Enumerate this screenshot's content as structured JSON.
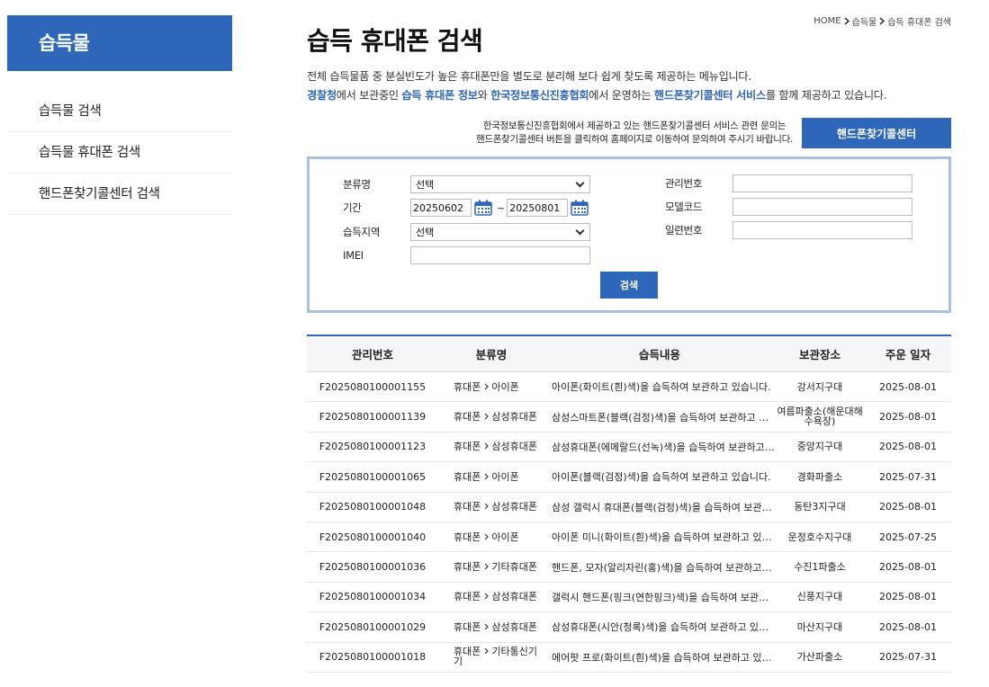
{
  "sidebar": {
    "title": "습득물",
    "items": [
      {
        "label": "습득물 검색"
      },
      {
        "label": "습득물 휴대폰 검색"
      },
      {
        "label": "핸드폰찾기콜센터 검색"
      }
    ]
  },
  "breadcrumb": [
    "HOME",
    "습득물",
    "습득 휴대폰 검색"
  ],
  "page": {
    "title": "습득 휴대폰 검색",
    "desc_line1": "전체 습득물품 중 분실빈도가 높은 휴대폰만을 별도로 분리해 보다 쉽게 찾도록 제공하는 메뉴입니다.",
    "desc_line2_parts": {
      "p1": "경찰청",
      "p2": "에서 보관중인 ",
      "p3": "습득 휴대폰 정보",
      "p4": "와 ",
      "p5": "한국정보통신진흥협회",
      "p6": "에서 운영하는 ",
      "p7": "핸드폰찾기콜센터 서비스",
      "p8": "를 함께 제공하고 있습니다."
    }
  },
  "callcenter": {
    "text_line1": "한국정보통신진흥협회에서 제공하고 있는 핸드폰찾기콜센터 서비스 관련 문의는",
    "text_line2": "핸드폰찾기콜센터 버튼을 클릭하여 홈페이지로 이동하여 문의하여 주시기 바랍니다.",
    "button_label": "핸드폰찾기콜센터"
  },
  "search_form": {
    "category_label": "분류명",
    "category_value": "선택",
    "period_label": "기간",
    "date_from": "20250602",
    "date_to": "20250801",
    "tilde": "~",
    "region_label": "습득지역",
    "region_value": "선택",
    "imei_label": "IMEI",
    "imei_value": "",
    "mgmt_no_label": "관리번호",
    "model_code_label": "모델코드",
    "serial_no_label": "일련번호",
    "search_button": "검색"
  },
  "table": {
    "headers": [
      "관리번호",
      "분류명",
      "습득내용",
      "보관장소",
      "주운 일자"
    ],
    "rows": [
      {
        "id": "F2025080100001155",
        "cat1": "휴대폰",
        "cat2": "아이폰",
        "content": "아이폰(화이트(흰)색)을 습득하여 보관하고 있습니다.",
        "place": "강서지구대",
        "date": "2025-08-01"
      },
      {
        "id": "F2025080100001139",
        "cat1": "휴대폰",
        "cat2": "삼성휴대폰",
        "content": "삼성스마트폰(블랙(검정)색)을 습득하여 보관하고 있습니다.",
        "place": "여름파출소(해운대해수욕장)",
        "date": "2025-08-01"
      },
      {
        "id": "F2025080100001123",
        "cat1": "휴대폰",
        "cat2": "삼성휴대폰",
        "content": "삼성휴대폰(에메랄드(선녹)색)을 습득하여 보관하고 있습니다.",
        "place": "중앙지구대",
        "date": "2025-08-01"
      },
      {
        "id": "F2025080100001065",
        "cat1": "휴대폰",
        "cat2": "아이폰",
        "content": "아이폰(블랙(검정)색)을 습득하여 보관하고 있습니다.",
        "place": "경화파출소",
        "date": "2025-07-31"
      },
      {
        "id": "F2025080100001048",
        "cat1": "휴대폰",
        "cat2": "삼성휴대폰",
        "content": "삼성 갤럭시 휴대폰(블랙(검정)색)을 습득하여 보관하고 있습니다.",
        "place": "동탄3지구대",
        "date": "2025-08-01"
      },
      {
        "id": "F2025080100001040",
        "cat1": "휴대폰",
        "cat2": "아이폰",
        "content": "아이폰 미니(화이트(흰)색)을 습득하여 보관하고 있습니다.",
        "place": "운정호수지구대",
        "date": "2025-07-25"
      },
      {
        "id": "F2025080100001036",
        "cat1": "휴대폰",
        "cat2": "기타휴대폰",
        "content": "핸드폰, 모자(알리자린(홍)색)을 습득하여 보관하고 있습니다.",
        "place": "수진1파출소",
        "date": "2025-08-01"
      },
      {
        "id": "F2025080100001034",
        "cat1": "휴대폰",
        "cat2": "삼성휴대폰",
        "content": "갤럭시 핸드폰(핑크(연한핑크)색)을 습득하여 보관하고 있습니다.",
        "place": "신풍지구대",
        "date": "2025-08-01"
      },
      {
        "id": "F2025080100001029",
        "cat1": "휴대폰",
        "cat2": "삼성휴대폰",
        "content": "삼성휴대폰(시안(청록)색)을 습득하여 보관하고 있습니다.",
        "place": "마산지구대",
        "date": "2025-08-01"
      },
      {
        "id": "F2025080100001018",
        "cat1": "휴대폰",
        "cat2": "기타통신기기",
        "content": "에어팟 프로(화이트(흰)색)을 습득하여 보관하고 있습니다.",
        "place": "가산파출소",
        "date": "2025-07-31"
      }
    ]
  },
  "icons": {
    "calendar": "calendar-icon",
    "chevron": "chevron-right-icon",
    "dropdown": "chevron-down-icon"
  },
  "colors": {
    "brand": "#2e66b9",
    "search_border": "#aac1e0"
  }
}
